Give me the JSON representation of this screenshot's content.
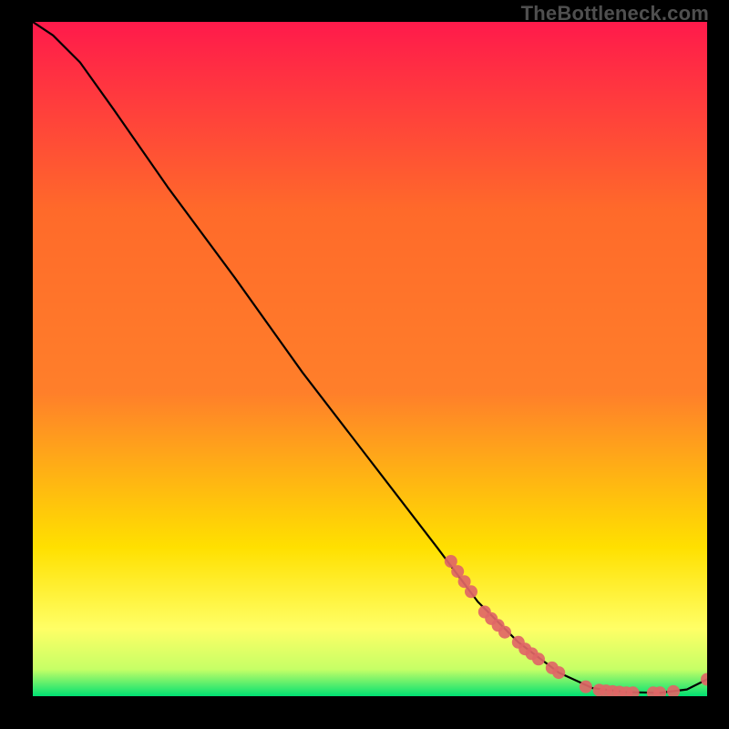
{
  "watermark": "TheBottleneck.com",
  "chart_data": {
    "type": "line",
    "title": "",
    "xlabel": "",
    "ylabel": "",
    "xlim": [
      0,
      100
    ],
    "ylim": [
      0,
      100
    ],
    "grid": false,
    "legend": false,
    "background_gradient": {
      "top": "#ff1a4b",
      "mid_upper": "#ff7f2a",
      "mid_lower": "#ffe000",
      "lower": "#ffff66",
      "bottom": "#00e072"
    },
    "curve": {
      "name": "bottleneck-curve",
      "color": "#000000",
      "points": [
        {
          "x": 0,
          "y": 100
        },
        {
          "x": 3,
          "y": 98
        },
        {
          "x": 7,
          "y": 94
        },
        {
          "x": 12,
          "y": 87
        },
        {
          "x": 20,
          "y": 75.5
        },
        {
          "x": 30,
          "y": 62
        },
        {
          "x": 40,
          "y": 48
        },
        {
          "x": 50,
          "y": 35
        },
        {
          "x": 60,
          "y": 22
        },
        {
          "x": 66,
          "y": 14
        },
        {
          "x": 72,
          "y": 8
        },
        {
          "x": 78,
          "y": 3.5
        },
        {
          "x": 83,
          "y": 1.2
        },
        {
          "x": 88,
          "y": 0.6
        },
        {
          "x": 93,
          "y": 0.5
        },
        {
          "x": 97,
          "y": 1.0
        },
        {
          "x": 100,
          "y": 2.5
        }
      ]
    },
    "markers": {
      "color": "#e06666",
      "radius": 7,
      "points": [
        {
          "x": 62,
          "y": 20.0
        },
        {
          "x": 63,
          "y": 18.5
        },
        {
          "x": 64,
          "y": 17.0
        },
        {
          "x": 65,
          "y": 15.5
        },
        {
          "x": 67,
          "y": 12.5
        },
        {
          "x": 68,
          "y": 11.5
        },
        {
          "x": 69,
          "y": 10.5
        },
        {
          "x": 70,
          "y": 9.5
        },
        {
          "x": 72,
          "y": 8.0
        },
        {
          "x": 73,
          "y": 7.0
        },
        {
          "x": 74,
          "y": 6.3
        },
        {
          "x": 75,
          "y": 5.5
        },
        {
          "x": 77,
          "y": 4.2
        },
        {
          "x": 78,
          "y": 3.5
        },
        {
          "x": 82,
          "y": 1.4
        },
        {
          "x": 84,
          "y": 0.9
        },
        {
          "x": 85,
          "y": 0.8
        },
        {
          "x": 86,
          "y": 0.7
        },
        {
          "x": 87,
          "y": 0.6
        },
        {
          "x": 88,
          "y": 0.5
        },
        {
          "x": 89,
          "y": 0.5
        },
        {
          "x": 92,
          "y": 0.5
        },
        {
          "x": 93,
          "y": 0.5
        },
        {
          "x": 95,
          "y": 0.7
        },
        {
          "x": 100,
          "y": 2.5
        }
      ]
    }
  }
}
